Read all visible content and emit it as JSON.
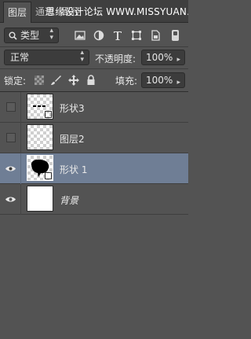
{
  "tabs": [
    {
      "label": "图层",
      "active": true
    },
    {
      "label": "通道",
      "active": false
    },
    {
      "label": "路径",
      "active": false
    }
  ],
  "watermark": "思缘设计论坛 WWW.MISSYUAN.COM",
  "filter": {
    "kind_label": "类型",
    "icons": [
      "image-filter-icon",
      "adjustment-filter-icon",
      "type-filter-icon",
      "shape-filter-icon",
      "smartobject-filter-icon",
      "filter-toggle-icon"
    ]
  },
  "blend": {
    "mode": "正常",
    "opacity_label": "不透明度:",
    "opacity_value": "100%"
  },
  "lock": {
    "label": "锁定:",
    "fill_label": "填充:",
    "fill_value": "100%"
  },
  "layers": [
    {
      "name": "形状3",
      "visible": false,
      "selected": false,
      "thumb": "checker-shape3"
    },
    {
      "name": "图层2",
      "visible": false,
      "selected": false,
      "thumb": "checker"
    },
    {
      "name": "形状 1",
      "visible": true,
      "selected": true,
      "thumb": "black-shape"
    },
    {
      "name": "背景",
      "visible": true,
      "selected": false,
      "thumb": "white",
      "italic": true
    }
  ],
  "colors": {
    "panel_bg": "#535353",
    "selected_row": "#6f7e95",
    "tabbar_bg": "#3f3f3f"
  }
}
